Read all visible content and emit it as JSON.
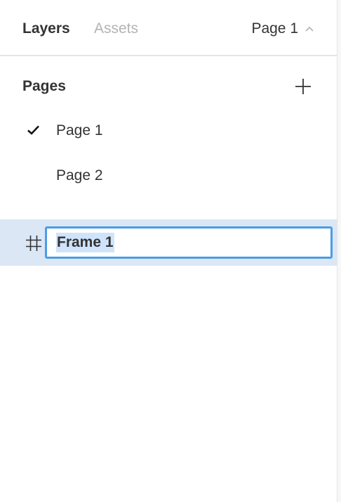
{
  "header": {
    "tabs": [
      {
        "label": "Layers",
        "active": true
      },
      {
        "label": "Assets",
        "active": false
      }
    ],
    "page_switcher": {
      "label": "Page 1",
      "icon": "chevron-up-icon"
    }
  },
  "pages": {
    "title": "Pages",
    "add_icon": "plus-icon",
    "items": [
      {
        "label": "Page 1",
        "selected": true,
        "icon": "checkmark-icon"
      },
      {
        "label": "Page 2",
        "selected": false
      }
    ]
  },
  "layers": {
    "rows": [
      {
        "icon": "frame-hash-icon",
        "name": "Frame 1",
        "editing": true,
        "selected": true
      }
    ]
  },
  "colors": {
    "selection_row": "#dbe7f5",
    "input_border": "#4a9de8",
    "text_selection": "#cfe3fb",
    "inactive_tab": "#b3b3b3"
  }
}
